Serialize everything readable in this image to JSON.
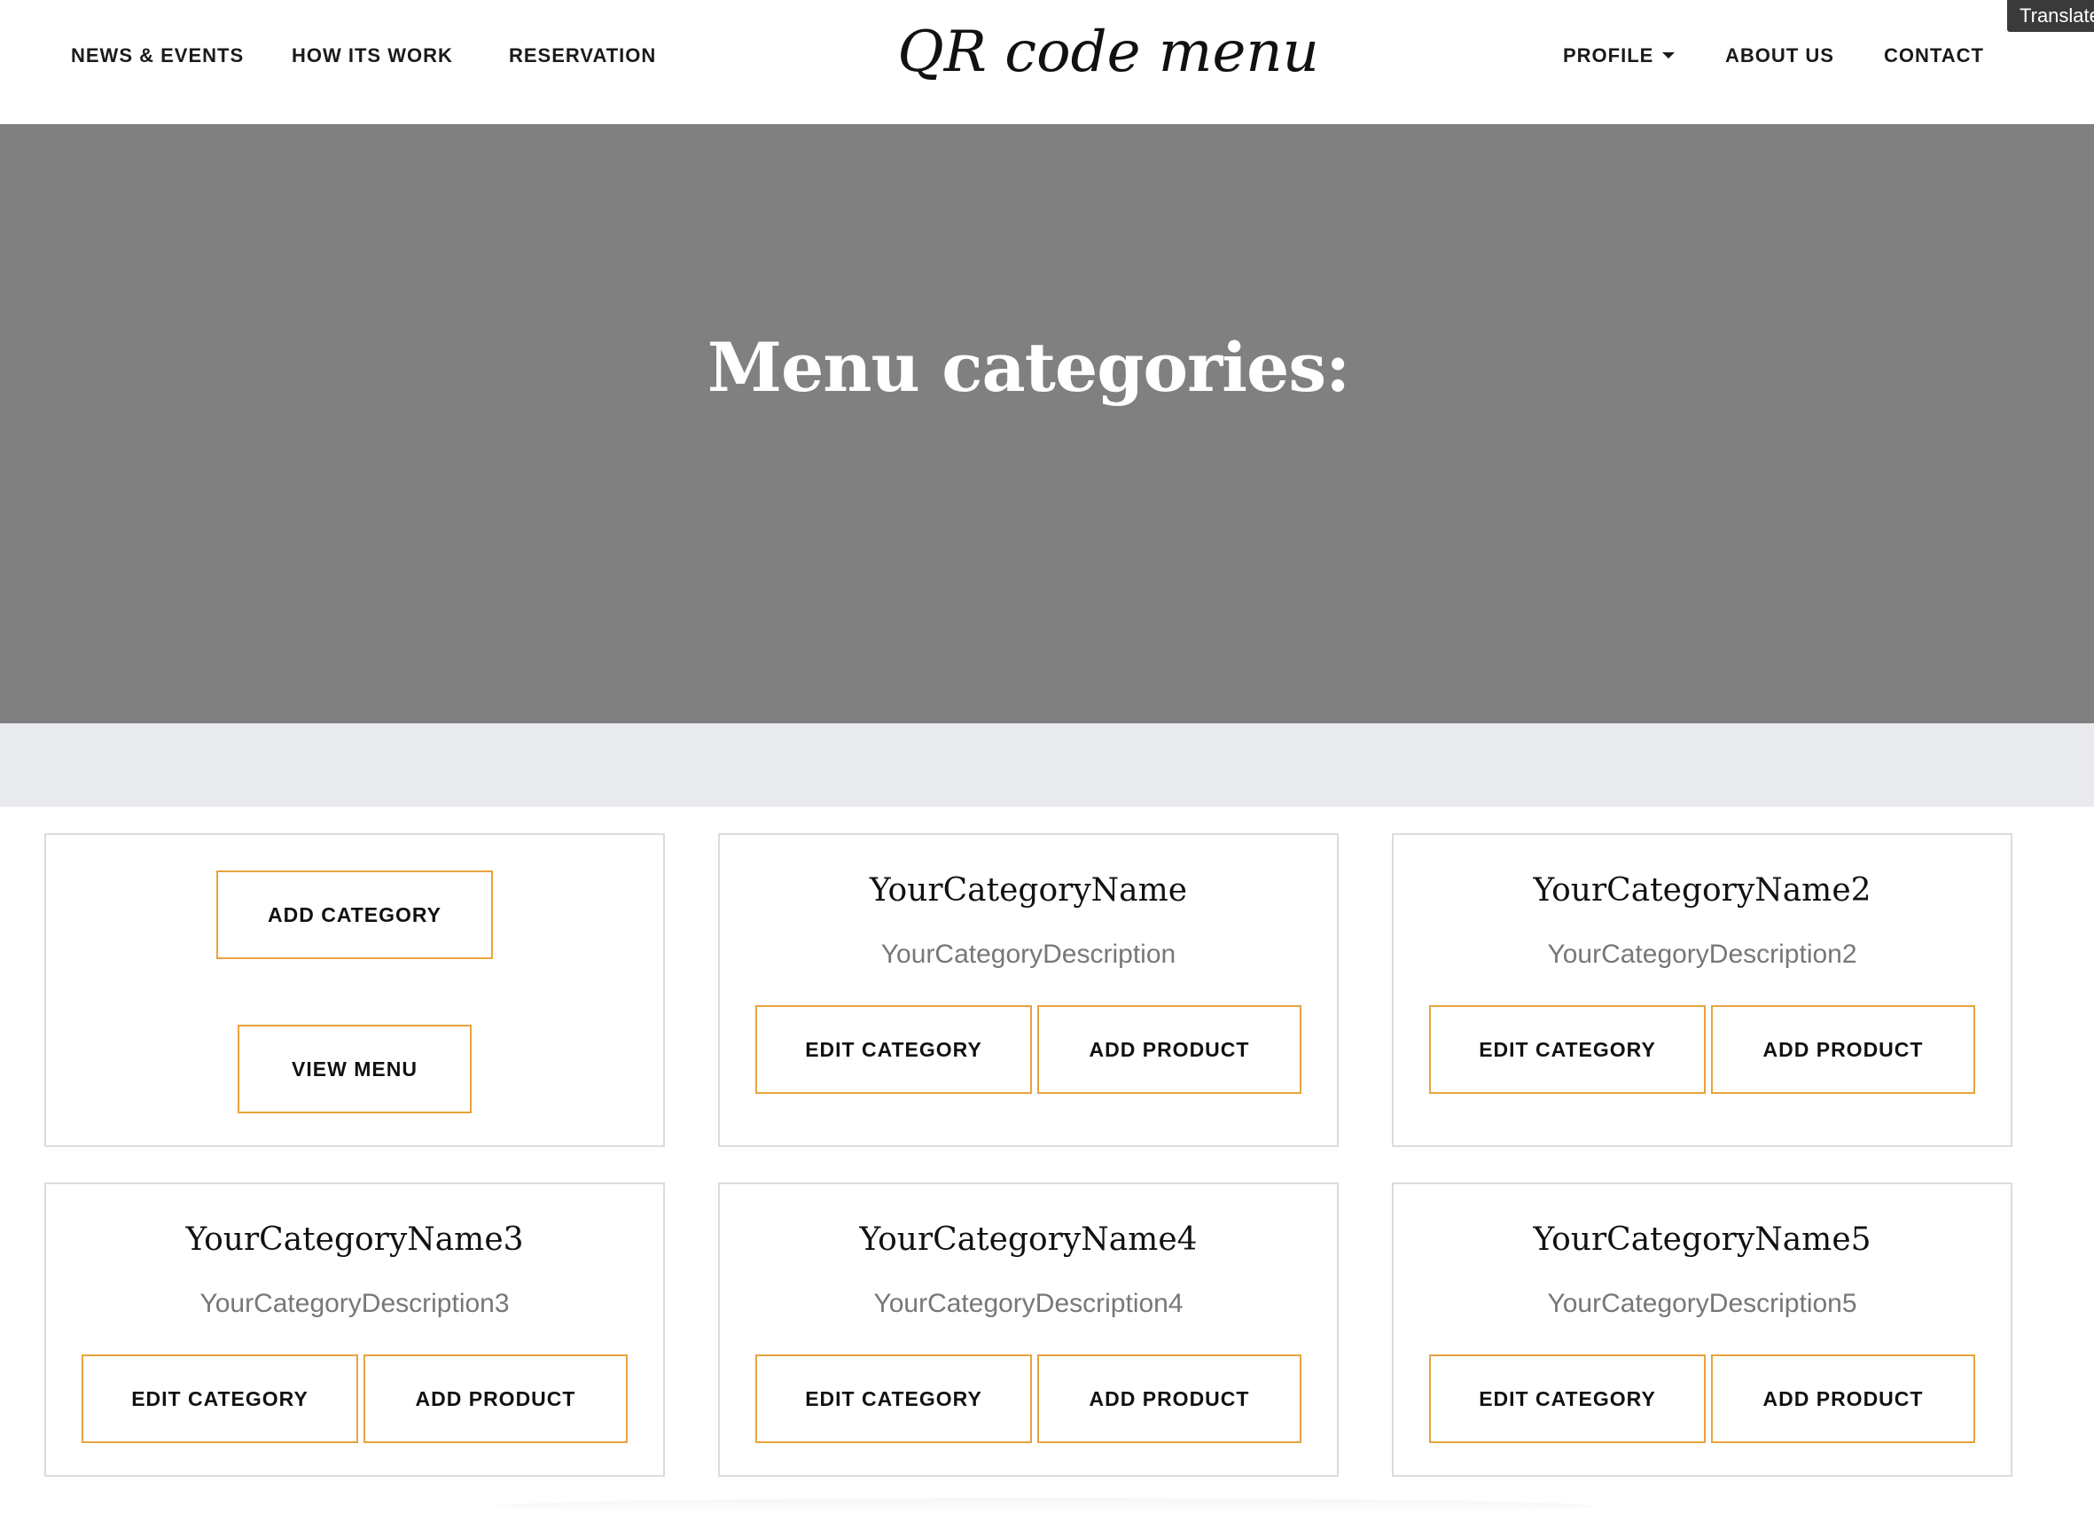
{
  "nav": {
    "left_links": [
      {
        "label": "NEWS & EVENTS"
      },
      {
        "label": "HOW ITS WORK"
      },
      {
        "label": "RESERVATION"
      }
    ],
    "brand": "QR code menu",
    "right_links": [
      {
        "label": "PROFILE",
        "has_dropdown": true
      },
      {
        "label": "ABOUT US"
      },
      {
        "label": "CONTACT"
      }
    ],
    "translate_label": "Translate"
  },
  "hero": {
    "title": "Menu categories:"
  },
  "actions_card": {
    "add_category_label": "ADD CATEGORY",
    "view_menu_label": "VIEW MENU"
  },
  "categories": [
    {
      "name": "YourCategoryName",
      "description": "YourCategoryDescription",
      "edit_label": "EDIT CATEGORY",
      "add_label": "ADD PRODUCT"
    },
    {
      "name": "YourCategoryName2",
      "description": "YourCategoryDescription2",
      "edit_label": "EDIT CATEGORY",
      "add_label": "ADD PRODUCT"
    },
    {
      "name": "YourCategoryName3",
      "description": "YourCategoryDescription3",
      "edit_label": "EDIT CATEGORY",
      "add_label": "ADD PRODUCT"
    },
    {
      "name": "YourCategoryName4",
      "description": "YourCategoryDescription4",
      "edit_label": "EDIT CATEGORY",
      "add_label": "ADD PRODUCT"
    },
    {
      "name": "YourCategoryName5",
      "description": "YourCategoryDescription5",
      "edit_label": "EDIT CATEGORY",
      "add_label": "ADD PRODUCT"
    }
  ],
  "colors": {
    "button_border": "#e8a33d",
    "hero_bg": "#808080",
    "band_bg": "#e9eaee",
    "card_border": "#dcdcdc"
  }
}
